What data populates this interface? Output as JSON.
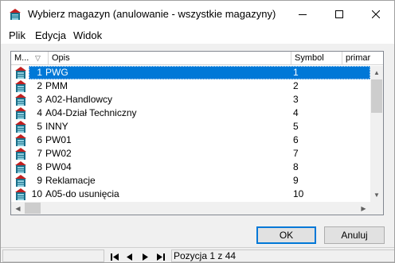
{
  "window": {
    "title": "Wybierz magazyn (anulowanie - wszystkie magazyny)"
  },
  "menu": [
    "Plik",
    "Edycja",
    "Widok"
  ],
  "columns": {
    "m": "M...",
    "opis": "Opis",
    "symbol": "Symbol",
    "primary": "primar"
  },
  "rows": [
    {
      "num": "1",
      "opis": "PWG",
      "symbol": "1"
    },
    {
      "num": "2",
      "opis": "PMM",
      "symbol": "2"
    },
    {
      "num": "3",
      "opis": "A02-Handlowcy",
      "symbol": "3"
    },
    {
      "num": "4",
      "opis": "A04-Dział Techniczny",
      "symbol": "4"
    },
    {
      "num": "5",
      "opis": "INNY",
      "symbol": "5"
    },
    {
      "num": "6",
      "opis": "PW01",
      "symbol": "6"
    },
    {
      "num": "7",
      "opis": "PW02",
      "symbol": "7"
    },
    {
      "num": "8",
      "opis": "PW04",
      "symbol": "8"
    },
    {
      "num": "9",
      "opis": "Reklamacje",
      "symbol": "9"
    },
    {
      "num": "10",
      "opis": "A05-do usunięcia",
      "symbol": "10"
    }
  ],
  "selected_index": 0,
  "buttons": {
    "ok": "OK",
    "cancel": "Anuluj"
  },
  "status": {
    "position": "Pozycja 1 z 44"
  },
  "colors": {
    "selection": "#0078d7",
    "warehouse_icon_roof": "#c02020",
    "warehouse_icon_body": "#1a6f8a"
  }
}
